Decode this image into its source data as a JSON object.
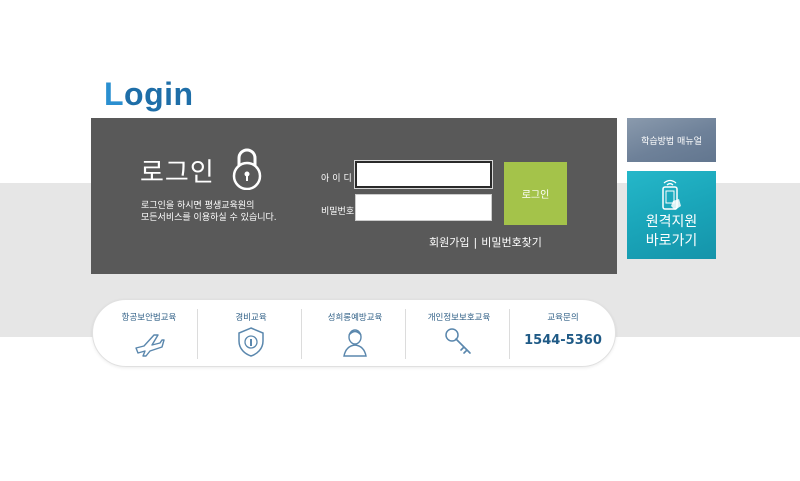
{
  "title": {
    "first": "L",
    "rest": "ogin"
  },
  "login": {
    "heading": "로그인",
    "desc_line1": "로그인을 하시면 평생교육원의",
    "desc_line2": "모든서비스를 이용하실 수 있습니다.",
    "id_label": "아이디",
    "pw_label": "비밀번호",
    "id_value": "",
    "pw_value": "",
    "button": "로그인",
    "signup": "회원가입",
    "separator": "|",
    "find_pw": "비밀번호찾기"
  },
  "side": {
    "manual": "학습방법 매뉴얼",
    "remote_line1": "원격지원",
    "remote_line2": "바로가기"
  },
  "education": [
    {
      "label": "항공보안법교육",
      "icon": "airplane-icon"
    },
    {
      "label": "경비교육",
      "icon": "shield-icon"
    },
    {
      "label": "성희롱예방교육",
      "icon": "person-icon"
    },
    {
      "label": "개인정보보호교육",
      "icon": "key-icon"
    },
    {
      "label": "교육문의",
      "phone": "1544-5360"
    }
  ],
  "colors": {
    "title": "#1e6ea8",
    "panel": "#595959",
    "login_button": "#a4c34a",
    "manual_button": "#6e8199",
    "remote_button": "#1aa5b9",
    "edu_text": "#2f5f86"
  }
}
